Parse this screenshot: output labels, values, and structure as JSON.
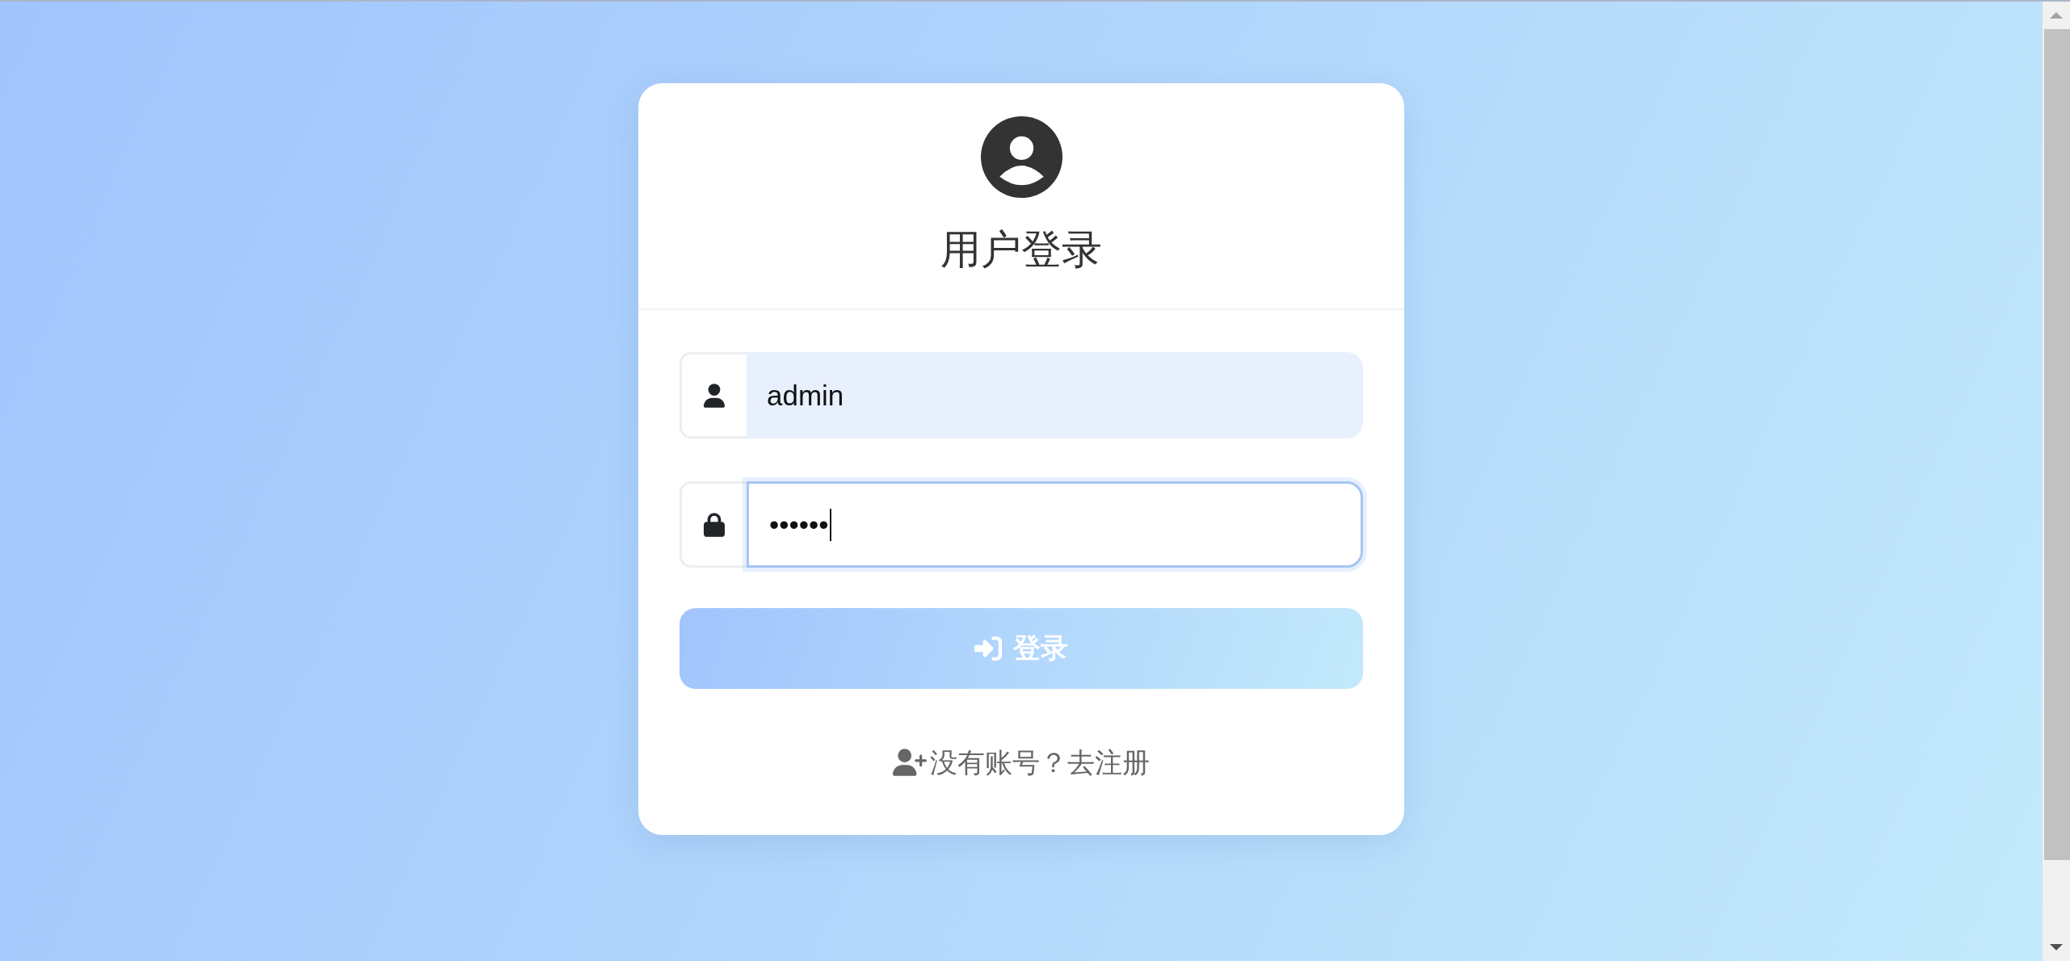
{
  "login_card": {
    "title": "用户登录",
    "fields": [
      {
        "kind": "username",
        "value": "admin",
        "autofilled": true,
        "focused": false
      },
      {
        "kind": "password",
        "value": "••••••",
        "autofilled": false,
        "focused": true
      }
    ],
    "login_button": {
      "label": "登录"
    },
    "register_link": {
      "label": "没有账号？去注册"
    }
  }
}
